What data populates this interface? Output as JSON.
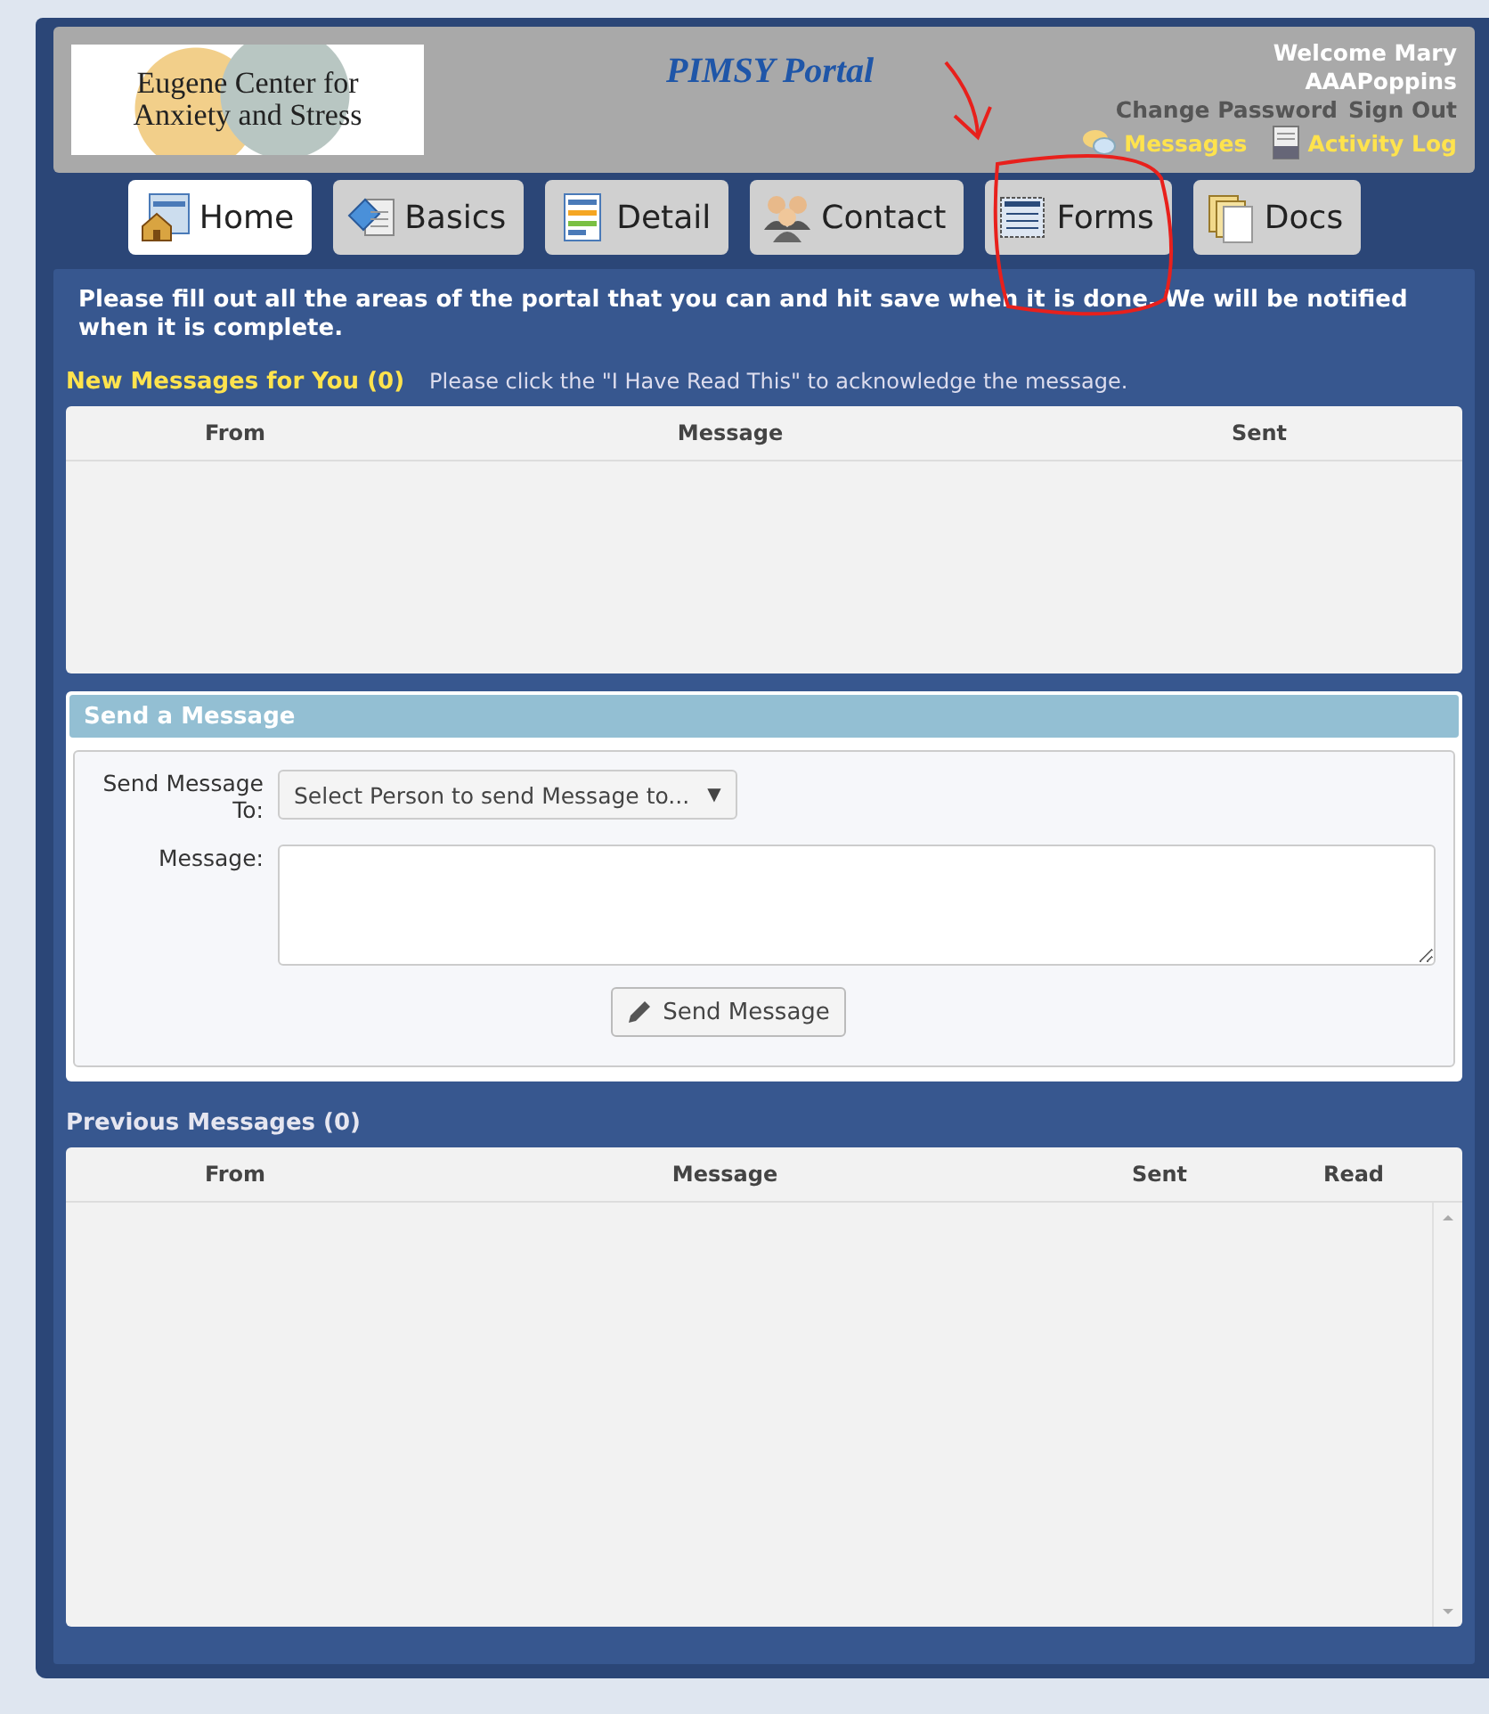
{
  "header": {
    "logo_lines": [
      "Eugene Center for",
      "Anxiety and Stress"
    ],
    "title": "PIMSY Portal",
    "welcome": "Welcome Mary",
    "username": "AAAPoppins",
    "account_links": [
      "Change Password",
      "Sign Out"
    ],
    "quick_links": [
      {
        "label": "Messages",
        "kind": "messages"
      },
      {
        "label": "Activity Log",
        "kind": "log"
      }
    ]
  },
  "tabs": [
    {
      "label": "Home",
      "kind": "home",
      "selected": true
    },
    {
      "label": "Basics",
      "kind": "basics",
      "selected": false
    },
    {
      "label": "Detail",
      "kind": "detail",
      "selected": false
    },
    {
      "label": "Contact",
      "kind": "contact",
      "selected": false
    },
    {
      "label": "Forms",
      "kind": "forms",
      "selected": false
    },
    {
      "label": "Docs",
      "kind": "docs",
      "selected": false
    }
  ],
  "intro": "Please fill out all the areas of the portal that you can and hit save when it is done.  We will be notified when it is complete.",
  "new_messages": {
    "title": "New Messages for You (0)",
    "hint": "Please click the \"I Have Read This\" to acknowledge the message.",
    "columns": [
      "From",
      "Message",
      "Sent"
    ]
  },
  "send_message": {
    "title": "Send a Message",
    "to_label": "Send Message To:",
    "select_placeholder": "Select Person to send Message to...",
    "select_caret": "▼",
    "message_label": "Message:",
    "button": "Send Message"
  },
  "previous_messages": {
    "title": "Previous Messages (0)",
    "columns": [
      "From",
      "Message",
      "Sent",
      "Read"
    ]
  },
  "annotation": {
    "kind": "arrow_circle"
  }
}
